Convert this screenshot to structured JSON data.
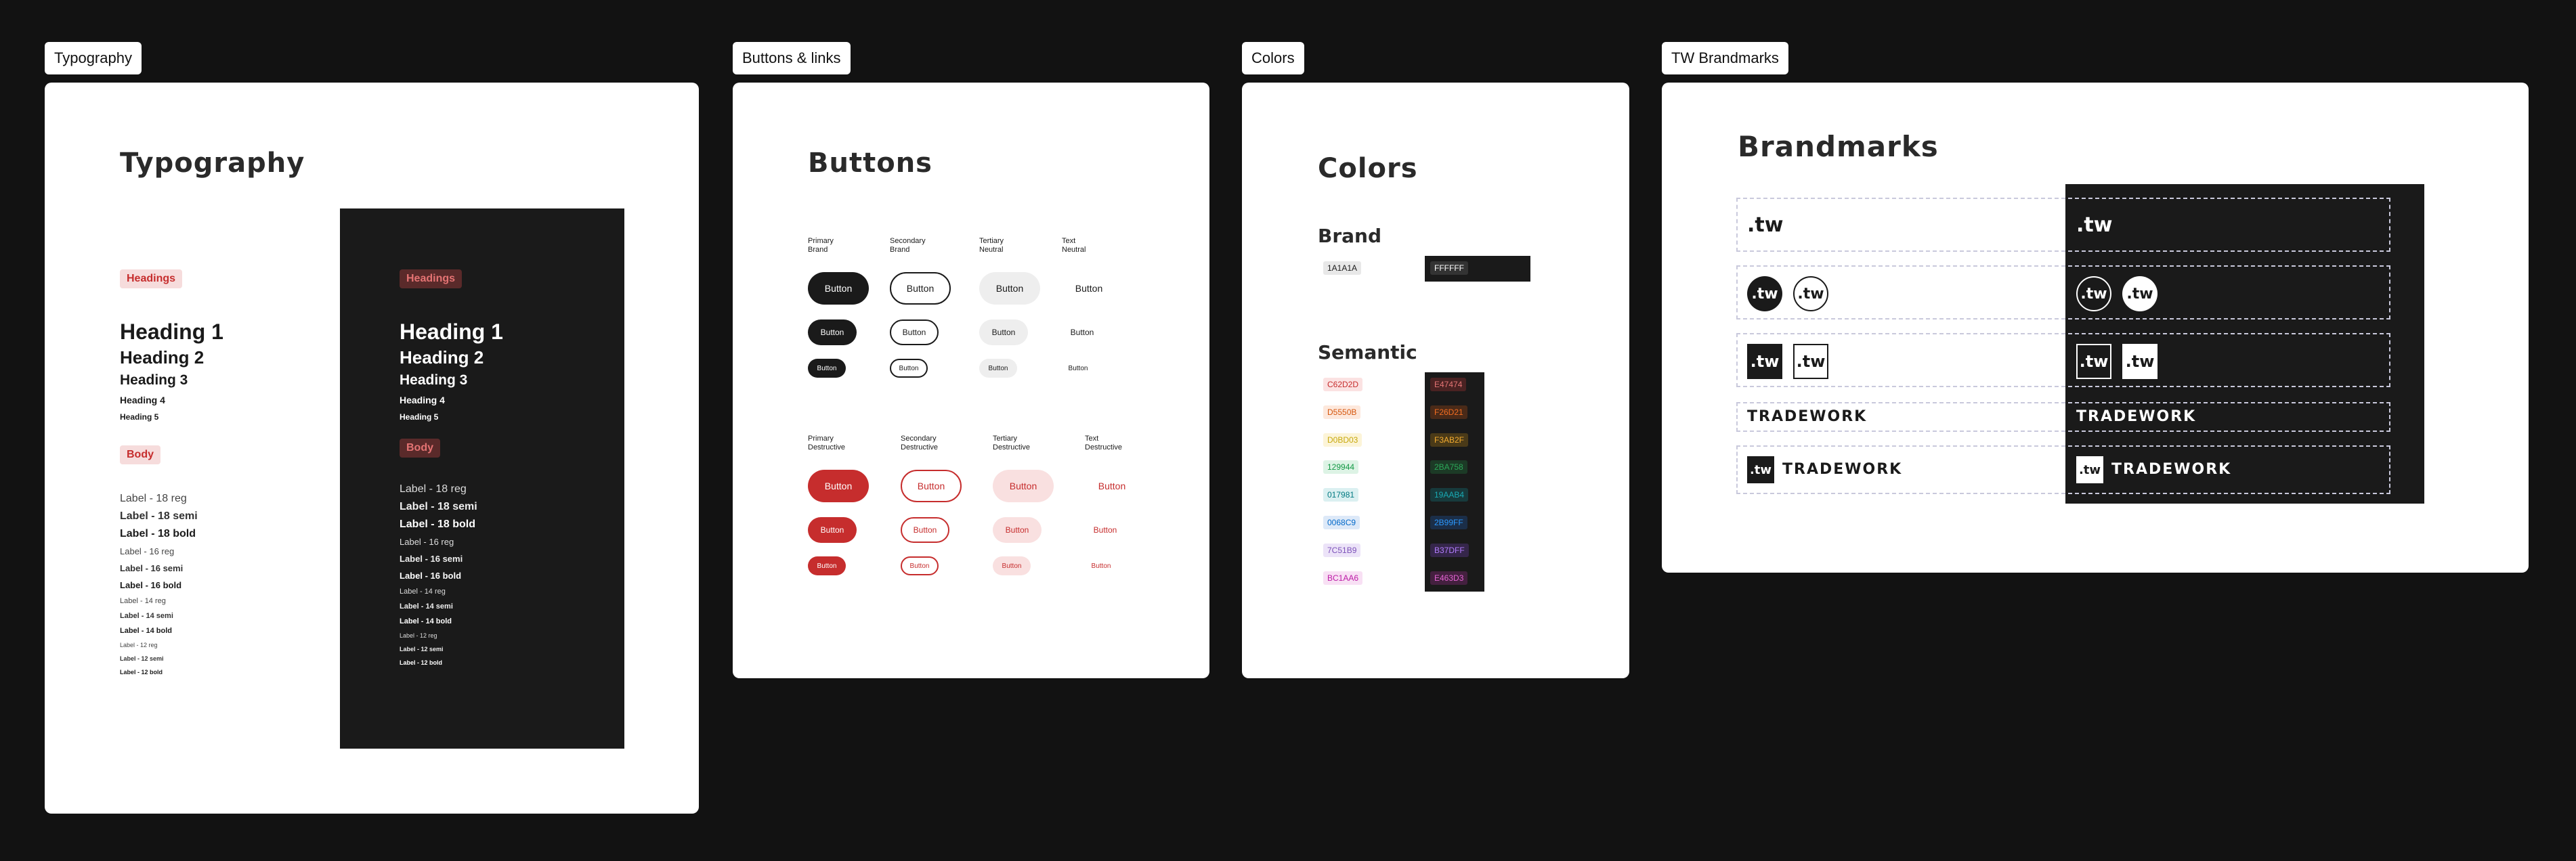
{
  "frames": {
    "typography": "Typography",
    "buttons": "Buttons & links",
    "colors": "Colors",
    "brandmarks": "TW Brandmarks"
  },
  "typography": {
    "title": "Typography",
    "headings_tag": "Headings",
    "body_tag": "Body",
    "headings": [
      "Heading 1",
      "Heading 2",
      "Heading 3",
      "Heading 4",
      "Heading 5"
    ],
    "labels": [
      "Label - 18 reg",
      "Label - 18 semi",
      "Label - 18 bold",
      "Label - 16 reg",
      "Label - 16 semi",
      "Label - 16 bold",
      "Label - 14 reg",
      "Label - 14 semi",
      "Label - 14 bold",
      "Label - 12 reg",
      "Label - 12 semi",
      "Label - 12 bold"
    ]
  },
  "buttons": {
    "title": "Buttons",
    "button_label": "Button",
    "brand_cols": [
      {
        "l1": "Primary",
        "l2": "Brand"
      },
      {
        "l1": "Secondary",
        "l2": "Brand"
      },
      {
        "l1": "Tertiary",
        "l2": "Neutral"
      },
      {
        "l1": "Text",
        "l2": "Neutral"
      }
    ],
    "destructive_cols": [
      {
        "l1": "Primary",
        "l2": "Destructive"
      },
      {
        "l1": "Secondary",
        "l2": "Destructive"
      },
      {
        "l1": "Tertiary",
        "l2": "Destructive"
      },
      {
        "l1": "Text",
        "l2": "Destructive"
      }
    ]
  },
  "colors": {
    "title": "Colors",
    "brand_heading": "Brand",
    "semantic_heading": "Semantic",
    "brand": [
      {
        "light": "1A1A1A",
        "dark": "FFFFFF"
      }
    ],
    "semantic": [
      {
        "light": "C62D2D",
        "dark": "E47474",
        "lc": "#c62d2d",
        "lb": "#fbe2e2",
        "dc": "#e47474",
        "db": "#4a2222"
      },
      {
        "light": "D5550B",
        "dark": "F26D21",
        "lc": "#d5550b",
        "lb": "#fde8dc",
        "dc": "#f26d21",
        "db": "#4a2a18"
      },
      {
        "light": "D0BD03",
        "dark": "F3AB2F",
        "lc": "#c7a80a",
        "lb": "#fcf4d8",
        "dc": "#f3ab2f",
        "db": "#4a3a18"
      },
      {
        "light": "129944",
        "dark": "2BA758",
        "lc": "#129944",
        "lb": "#ddf3e5",
        "dc": "#2ba758",
        "db": "#1c3a26"
      },
      {
        "light": "017981",
        "dark": "19AAB4",
        "lc": "#017981",
        "lb": "#dbf0f1",
        "dc": "#19aab4",
        "db": "#173a3c"
      },
      {
        "light": "0068C9",
        "dark": "2B99FF",
        "lc": "#0068c9",
        "lb": "#dde9f8",
        "dc": "#2b99ff",
        "db": "#1b2e48"
      },
      {
        "light": "7C51B9",
        "dark": "B37DFF",
        "lc": "#7c51b9",
        "lb": "#ece3f8",
        "dc": "#b37dff",
        "db": "#35264a"
      },
      {
        "light": "BC1AA6",
        "dark": "E463D3",
        "lc": "#bc1aa6",
        "lb": "#f8e0f4",
        "dc": "#e463d3",
        "db": "#44203f"
      }
    ]
  },
  "brandmarks": {
    "title": "Brandmarks",
    "logo_text": ".tw",
    "wordmark": "TRADEWORK"
  }
}
